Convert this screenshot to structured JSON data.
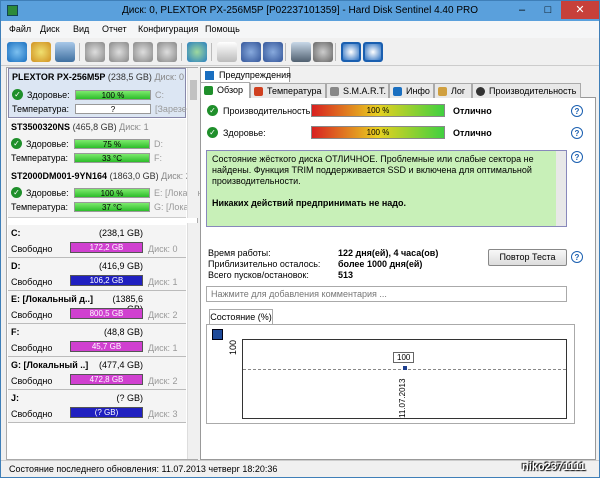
{
  "window": {
    "title": "Диск: 0, PLEXTOR PX-256M5P [P02237101359]  -  Hard Disk Sentinel 4.40 PRO",
    "min": "–",
    "max": "□",
    "close": "✕"
  },
  "menu": [
    "Файл",
    "Диск",
    "Вид",
    "Отчет",
    "Конфигурация",
    "Помощь"
  ],
  "disks": [
    {
      "name": "PLEXTOR PX-256M5P",
      "size": "(238,5 GB)",
      "disk": "Диск: 0",
      "health_label": "Здоровье:",
      "health": "100 %",
      "health_pct": 100,
      "vol": "C:",
      "temp_label": "Температура:",
      "temp": "?",
      "temp_extra": "[Зарезер"
    },
    {
      "name": "ST3500320NS",
      "size": "(465,8 GB)",
      "disk": "Диск: 1",
      "health_label": "Здоровье:",
      "health": "75 %",
      "health_pct": 75,
      "vol": "D:",
      "temp_label": "Температура:",
      "temp": "33 °C",
      "temp_extra": "F:"
    },
    {
      "name": "ST2000DM001-9YN164",
      "size": "(1863,0 GB)",
      "disk": "Диск: 2",
      "health_label": "Здоровье:",
      "health": "100 %",
      "health_pct": 100,
      "vol": "E: [Локальн",
      "temp_label": "Температура:",
      "temp": "37 °C",
      "temp_extra": "G: [Локал"
    }
  ],
  "volumes": [
    {
      "name": "C:",
      "size": "(238,1 GB)",
      "free_label": "Свободно",
      "free": "172,2 GB",
      "color": "#d040d0",
      "disk": "Диск: 0"
    },
    {
      "name": "D:",
      "size": "(416,9 GB)",
      "free_label": "Свободно",
      "free": "106,2 GB",
      "color": "#2020c0",
      "disk": "Диск: 1"
    },
    {
      "name": "E: [Локальный д..]",
      "size": "(1385,6 GB)",
      "free_label": "Свободно",
      "free": "800,5 GB",
      "color": "#d040d0",
      "disk": "Диск: 2"
    },
    {
      "name": "F:",
      "size": "(48,8 GB)",
      "free_label": "Свободно",
      "free": "45,7 GB",
      "color": "#d040d0",
      "disk": "Диск: 1"
    },
    {
      "name": "G: [Локальный ..]",
      "size": "(477,4 GB)",
      "free_label": "Свободно",
      "free": "472,8 GB",
      "color": "#d040d0",
      "disk": "Диск: 2"
    },
    {
      "name": "J:",
      "size": "(? GB)",
      "free_label": "Свободно",
      "free": "(? GB)",
      "color": "#2020c0",
      "disk": "Диск: 3"
    }
  ],
  "tabs": {
    "warnings": "Предупреждения",
    "items": [
      "Обзор",
      "Температура",
      "S.M.A.R.T.",
      "Инфо",
      "Лог",
      "Производительность"
    ]
  },
  "overview": {
    "perf_label": "Производительность:",
    "perf_value": "100 %",
    "perf_pct": 100,
    "perf_status": "Отлично",
    "health_label": "Здоровье:",
    "health_value": "100 %",
    "health_pct": 100,
    "health_status": "Отлично",
    "status_p1": "Состояние жёсткого диска ОТЛИЧНОЕ. Проблемные или слабые сектора не найдены. Функция TRIM поддерживается SSD и включена для оптимальной производительности.",
    "status_p2": "Никаких действий предпринимать не надо.",
    "uptime_label": "Время работы:",
    "uptime": "122 дня(ей), 4 часа(ов)",
    "remaining_label": "Приблизительно осталось:",
    "remaining": "более 1000 дня(ей)",
    "starts_label": "Всего пусков/остановок:",
    "starts": "513",
    "retest": "Повтор Теста",
    "comment_placeholder": "Нажмите для добавления комментария ...",
    "chart_tab": "Состояние (%)"
  },
  "chart_data": {
    "type": "line",
    "x": [
      "11.07.2013"
    ],
    "values": [
      100
    ],
    "ylabel": "",
    "ytick": "100"
  },
  "statusbar": "Состояние последнего обновления: 11.07.2013 четверг 18:20:36",
  "watermark": "niko2371111"
}
